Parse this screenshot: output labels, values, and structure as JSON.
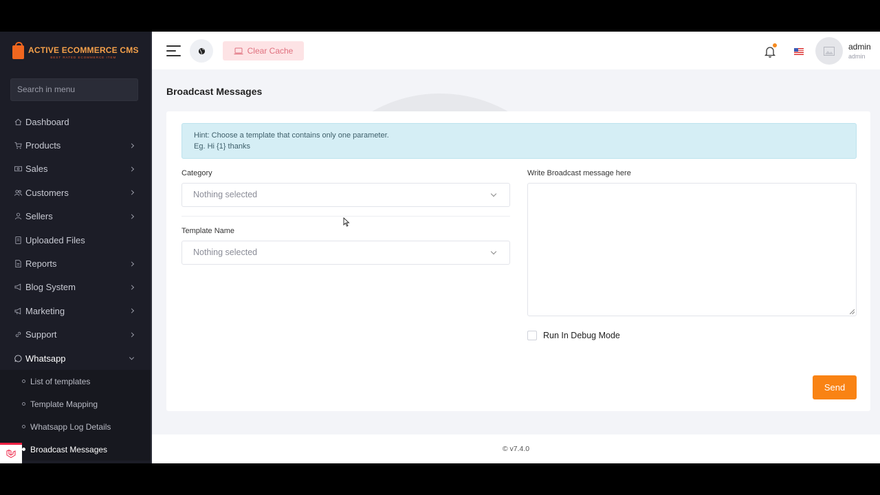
{
  "brand": {
    "name": "ACTIVE ECOMMERCE CMS",
    "tagline": "BEST RATED ECOMMERCE ITEM"
  },
  "sidebar": {
    "search_placeholder": "Search in menu",
    "items": [
      {
        "label": "Dashboard",
        "icon": "home-icon"
      },
      {
        "label": "Products",
        "icon": "cart-icon"
      },
      {
        "label": "Sales",
        "icon": "money-icon"
      },
      {
        "label": "Customers",
        "icon": "users-icon"
      },
      {
        "label": "Sellers",
        "icon": "user-icon"
      },
      {
        "label": "Uploaded Files",
        "icon": "file-icon"
      },
      {
        "label": "Reports",
        "icon": "report-icon"
      },
      {
        "label": "Blog System",
        "icon": "megaphone-icon"
      },
      {
        "label": "Marketing",
        "icon": "bullhorn-icon"
      },
      {
        "label": "Support",
        "icon": "link-icon"
      },
      {
        "label": "Whatsapp",
        "icon": "whatsapp-icon"
      }
    ],
    "whatsapp_sub": [
      "List of templates",
      "Template Mapping",
      "Whatsapp Log Details",
      "Broadcast Messages"
    ]
  },
  "topbar": {
    "clear_cache": "Clear Cache",
    "user_name": "admin",
    "user_role": "admin"
  },
  "page": {
    "title": "Broadcast Messages",
    "hint_line1": "Hint: Choose a template that contains only one parameter.",
    "hint_line2": "Eg. Hi {1} thanks",
    "category_label": "Category",
    "category_value": "Nothing selected",
    "template_label": "Template Name",
    "template_value": "Nothing selected",
    "message_label": "Write Broadcast message here",
    "debug_label": "Run In Debug Mode",
    "send_label": "Send"
  },
  "footer": {
    "version": "© v7.4.0"
  },
  "colors": {
    "accent": "#f98314",
    "sidebar_bg": "#1c1d27",
    "hint_bg": "#d5eef5",
    "cache_bg": "#fde3e5"
  }
}
